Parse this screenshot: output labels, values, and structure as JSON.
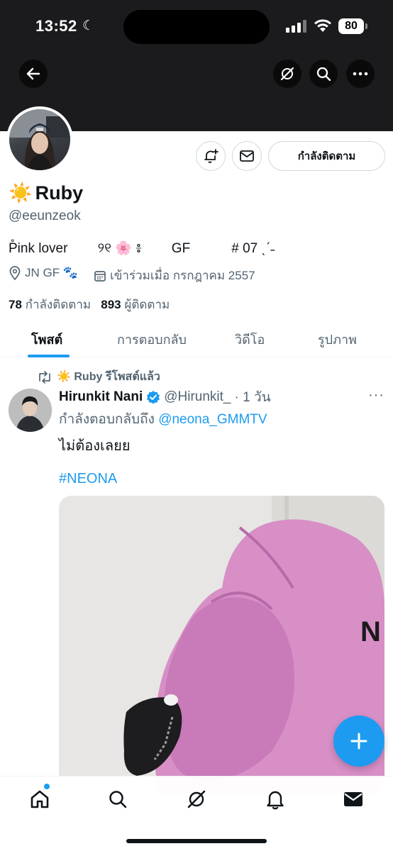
{
  "status_bar": {
    "time": "13:52",
    "battery": "80"
  },
  "profile": {
    "name": "Ruby",
    "name_emoji": "☀️",
    "handle": "@eeunzeok",
    "bio": "P̊ink lover        ୨୧ 🌸 ៖        GF           # 07 ˎˊ˗",
    "location": "JN GF 🐾",
    "joined": "เข้าร่วมเมื่อ กรกฎาคม 2557",
    "following_count": "78",
    "following_label": "กำลังติดตาม",
    "followers_count": "893",
    "followers_label": "ผู้ติดตาม",
    "follow_button": "กำลังติดตาม"
  },
  "tabs": [
    {
      "label": "โพสต์"
    },
    {
      "label": "การตอบกลับ"
    },
    {
      "label": "วิดีโอ"
    },
    {
      "label": "รูปภาพ"
    }
  ],
  "post": {
    "repost_by": "☀️ Ruby รีโพสต์แล้ว",
    "author_name": "Hirunkit Nani",
    "author_handle": "@Hirunkit_",
    "time": "· 1 วัน",
    "reply_to_prefix": "กำลังตอบกลับถึง",
    "reply_to_mention": "@neona_GMMTV",
    "text": "ไม่ต้องเลยย",
    "hashtag": "#NEONA",
    "more": "···"
  },
  "colors": {
    "accent": "#1d9bf0",
    "banner": "#1b1b1d",
    "secondary_text": "#536471"
  },
  "icons": [
    "back-arrow-icon",
    "grok-icon",
    "search-icon",
    "more-icon",
    "notification-bell-plus-icon",
    "mail-icon",
    "location-icon",
    "calendar-icon",
    "repost-icon",
    "verified-icon",
    "plus-icon",
    "home-icon",
    "bell-icon"
  ]
}
